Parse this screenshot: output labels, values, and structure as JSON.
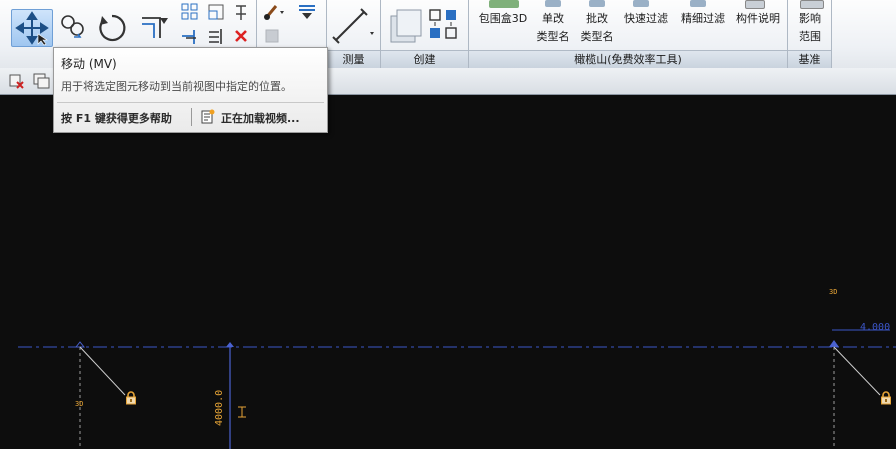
{
  "ribbon": {
    "panels": {
      "measure": "测量",
      "create": "创建",
      "plugin": "橄榄山(免费效率工具)",
      "datum": "基准"
    },
    "buttons": {
      "bbox3d": "包围盒3D",
      "single_change_1": "单改",
      "single_change_2": "类型名",
      "batch_change_1": "批改",
      "batch_change_2": "类型名",
      "quick_filter": "快速过滤",
      "fine_filter": "精细过滤",
      "component_desc": "构件说明",
      "influence_1": "影响",
      "influence_2": "范围"
    }
  },
  "tooltip": {
    "title": "移动 (MV)",
    "description": "用于将选定图元移动到当前视图中指定的位置。",
    "help": "按 F1 键获得更多帮助",
    "loading": "正在加载视频..."
  },
  "canvas": {
    "label_3d_right": "3D",
    "label_3d_left": "3D",
    "level_value": "4.000",
    "dimension_value": "4000.0",
    "colors": {
      "level_line": "#3c56c8",
      "annotation": "#e6a436",
      "background": "#0d0d0d"
    }
  }
}
